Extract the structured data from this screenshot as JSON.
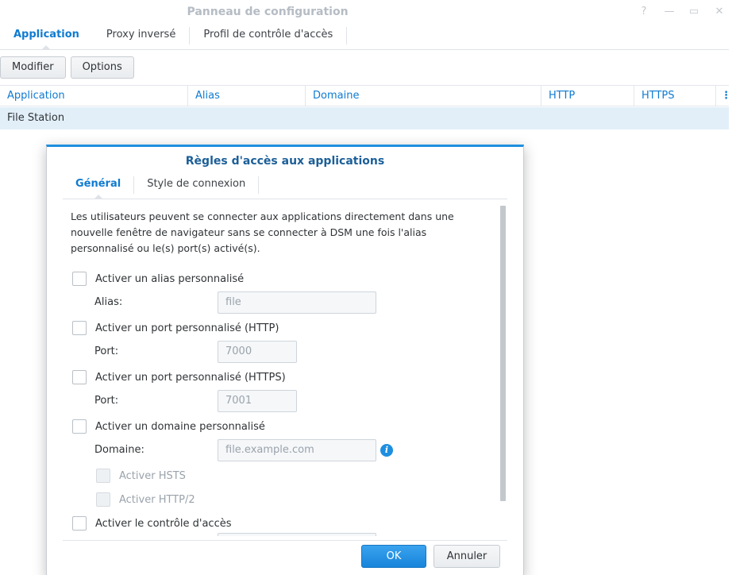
{
  "window": {
    "title": "Panneau de configuration",
    "controls": [
      "help-icon",
      "minimize-icon",
      "maximize-icon",
      "close-icon"
    ]
  },
  "tabs": [
    {
      "label": "Application",
      "active": true
    },
    {
      "label": "Proxy inversé",
      "active": false
    },
    {
      "label": "Profil de contrôle d'accès",
      "active": false
    }
  ],
  "toolbar": {
    "modify_label": "Modifier",
    "options_label": "Options"
  },
  "grid": {
    "columns": [
      "Application",
      "Alias",
      "Domaine",
      "HTTP",
      "HTTPS"
    ],
    "more_icon": "⋮",
    "rows": [
      [
        "File Station",
        "",
        "",
        "",
        ""
      ]
    ]
  },
  "dialog": {
    "title": "Règles d'accès aux applications",
    "tabs": [
      {
        "label": "Général",
        "active": true
      },
      {
        "label": "Style de connexion",
        "active": false
      }
    ],
    "description": "Les utilisateurs peuvent se connecter aux applications directement dans une nouvelle fenêtre de navigateur sans se connecter à DSM une fois l'alias personnalisé ou le(s) port(s) activé(s).",
    "custom_alias": {
      "checkbox_label": "Activer un alias personnalisé",
      "field_label": "Alias:",
      "placeholder": "file"
    },
    "http_port": {
      "checkbox_label": "Activer un port personnalisé (HTTP)",
      "field_label": "Port:",
      "placeholder": "7000"
    },
    "https_port": {
      "checkbox_label": "Activer un port personnalisé (HTTPS)",
      "field_label": "Port:",
      "placeholder": "7001"
    },
    "custom_domain": {
      "checkbox_label": "Activer un domaine personnalisé",
      "field_label": "Domaine:",
      "placeholder": "file.example.com"
    },
    "hsts_label": "Activer HSTS",
    "http2_label": "Activer HTTP/2",
    "access_control_label": "Activer le contrôle d'accès",
    "ok_label": "OK",
    "cancel_label": "Annuler"
  },
  "colors": {
    "accent": "#0f7bd1",
    "selected_row": "#e2eff9",
    "dialog_border": "#1e8fdf"
  }
}
